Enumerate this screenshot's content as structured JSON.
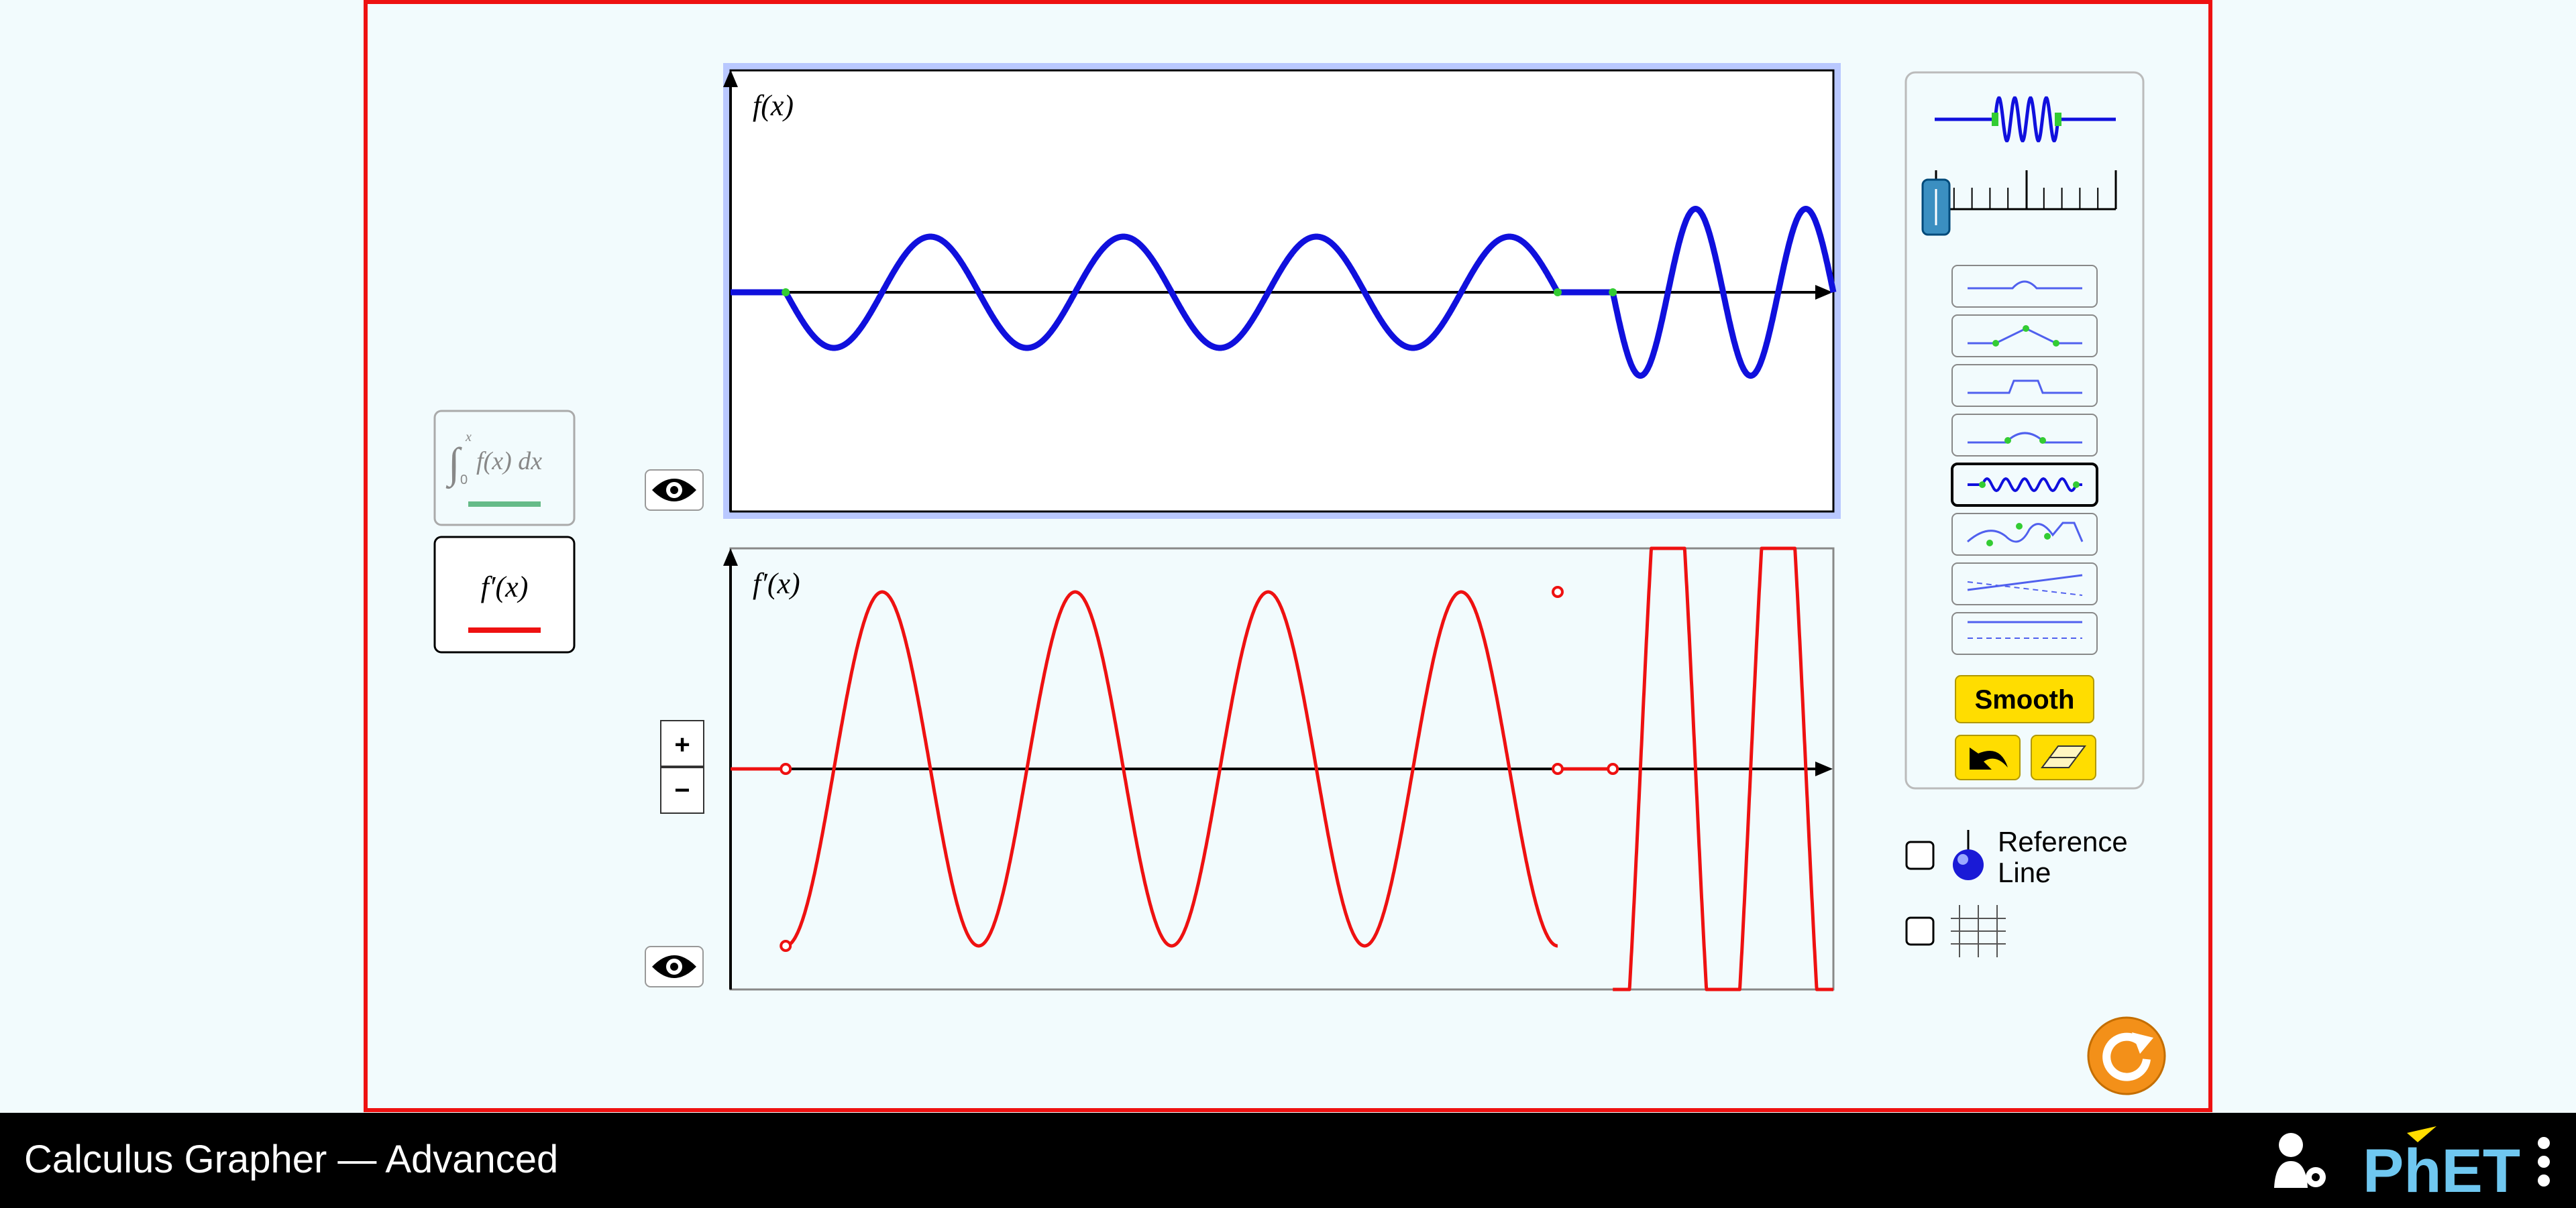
{
  "app": {
    "title": "Calculus Grapher — Advanced",
    "brand": "PhET"
  },
  "colors": {
    "background": "#f2fbfd",
    "frame": "#ee1111",
    "function_curve": "#1010dd",
    "derivative_curve": "#ee1111",
    "integral_line": "#66bb88",
    "point_marker": "#33cc33",
    "smooth_button": "#ffdd00",
    "reset_button": "#f39019",
    "navbar": "#000000"
  },
  "graph_selector": {
    "integral": {
      "label": "∫₀ˣ f(x) dx",
      "lower_limit": "0",
      "upper_limit": "x",
      "body": "f(x) dx",
      "selected": false
    },
    "derivative": {
      "label": "f′(x)",
      "selected": true
    }
  },
  "top_graph": {
    "label": "f(x)",
    "visibility_icon": "eye-icon"
  },
  "bottom_graph": {
    "label": "f′(x)",
    "visibility_icon": "eye-icon",
    "zoom_in": "+",
    "zoom_out": "−"
  },
  "curve_tools": {
    "selected_preview": "sinusoid",
    "width_slider_value": 0,
    "shapes": [
      "hill",
      "triangle",
      "pedestal",
      "parabola",
      "sinusoid",
      "freeform",
      "tilt",
      "shift"
    ],
    "selected_shape": "sinusoid",
    "smooth_label": "Smooth",
    "undo_icon": "undo-arrow-icon",
    "erase_icon": "eraser-icon"
  },
  "checkboxes": {
    "reference_line": {
      "label_line1": "Reference",
      "label_line2": "Line",
      "checked": false,
      "icon": "reference-line-icon"
    },
    "grid": {
      "checked": false,
      "icon": "grid-icon"
    }
  },
  "reset_icon": "reset-all-icon",
  "navbar_icons": [
    "user-settings-icon",
    "phet-logo",
    "kebab-menu-icon"
  ],
  "chart_data": [
    {
      "type": "line",
      "label": "f(x)",
      "series": [
        {
          "segment": "flat",
          "x": [
            0,
            1
          ],
          "y": [
            0,
            0
          ]
        },
        {
          "segment": "sinusoid",
          "x": [
            1,
            15
          ],
          "shape": "4 periods, amplitude 1, starts downward"
        },
        {
          "segment": "flat",
          "x": [
            15,
            16
          ],
          "y": [
            0,
            0
          ]
        },
        {
          "segment": "sinusoid",
          "x": [
            16,
            20
          ],
          "shape": "2 fast periods, amplitude 1.5, starts downward"
        }
      ]
    },
    {
      "type": "line",
      "label": "f′(x)",
      "series": [
        {
          "segment": "flat",
          "x": [
            0,
            1
          ],
          "y": [
            0,
            0
          ]
        },
        {
          "segment": "cosine",
          "x": [
            1,
            15
          ],
          "shape": "derivative of f, amplitude 3.3"
        },
        {
          "segment": "flat",
          "x": [
            15,
            16
          ],
          "y": [
            0,
            0
          ]
        },
        {
          "segment": "steep",
          "x": [
            16,
            20
          ],
          "shape": "off-scale near-vertical lines"
        }
      ],
      "open_points": [
        [
          1,
          0
        ],
        [
          1,
          -3.3
        ],
        [
          15,
          0
        ],
        [
          15,
          3.3
        ],
        [
          16,
          0
        ]
      ]
    }
  ]
}
